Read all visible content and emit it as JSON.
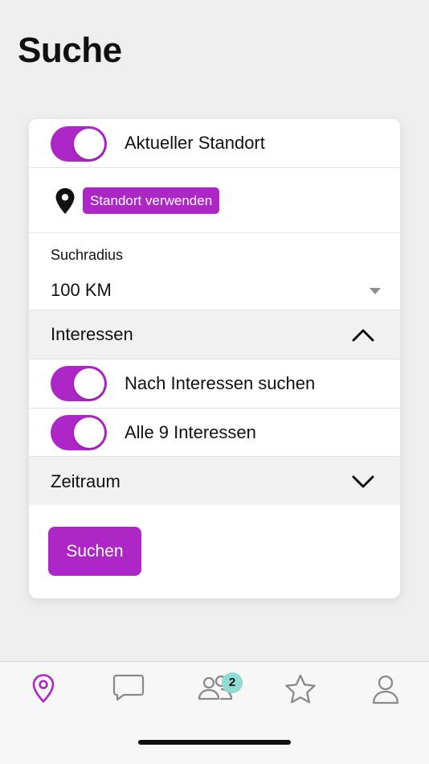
{
  "page": {
    "title": "Suche"
  },
  "location": {
    "toggle_label": "Aktueller Standort",
    "toggle_on": true,
    "use_location_label": "Standort verwenden"
  },
  "radius": {
    "label": "Suchradius",
    "value": "100 KM"
  },
  "interests": {
    "section_label": "Interessen",
    "expanded": true,
    "search_by_interests_label": "Nach Interessen suchen",
    "all_interests_label": "Alle 9 Interessen"
  },
  "timeframe": {
    "section_label": "Zeitraum",
    "expanded": false
  },
  "search_button": "Suchen",
  "tabbar": {
    "active_tab": "map-pin",
    "tabs": [
      "map-pin-icon",
      "chat-bubble-icon",
      "contacts-icon",
      "star-icon",
      "profile-icon"
    ],
    "contacts_badge": "2"
  },
  "colors": {
    "accent": "#ad27c6",
    "badge": "#8fdcd3"
  }
}
